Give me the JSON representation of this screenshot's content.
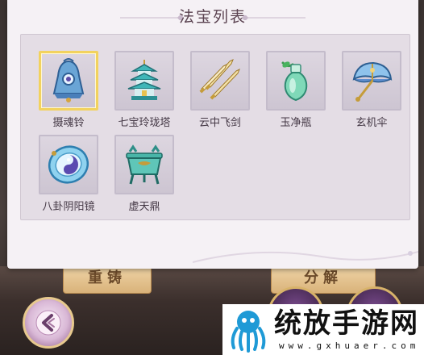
{
  "panel": {
    "title": "法宝列表"
  },
  "items": [
    {
      "name": "摄魂铃",
      "selected": true,
      "icon": "bell-icon"
    },
    {
      "name": "七宝玲珑塔",
      "selected": false,
      "icon": "pagoda-icon"
    },
    {
      "name": "云中飞剑",
      "selected": false,
      "icon": "flying-swords-icon"
    },
    {
      "name": "玉净瓶",
      "selected": false,
      "icon": "jade-vase-icon"
    },
    {
      "name": "玄机伞",
      "selected": false,
      "icon": "umbrella-icon"
    },
    {
      "name": "八卦阴阳镜",
      "selected": false,
      "icon": "yin-yang-mirror-icon"
    },
    {
      "name": "虚天鼎",
      "selected": false,
      "icon": "cauldron-icon"
    }
  ],
  "background": {
    "recast_label": "重铸",
    "decompose_label": "分解"
  },
  "watermark": {
    "title": "统放手游网",
    "url": "www.gxhuaer.com"
  },
  "colors": {
    "panel_bg": "#f5f1f5",
    "inner_bg": "#e4dde5",
    "selected_border": "#f2d25e",
    "title_text": "#5a4250"
  }
}
